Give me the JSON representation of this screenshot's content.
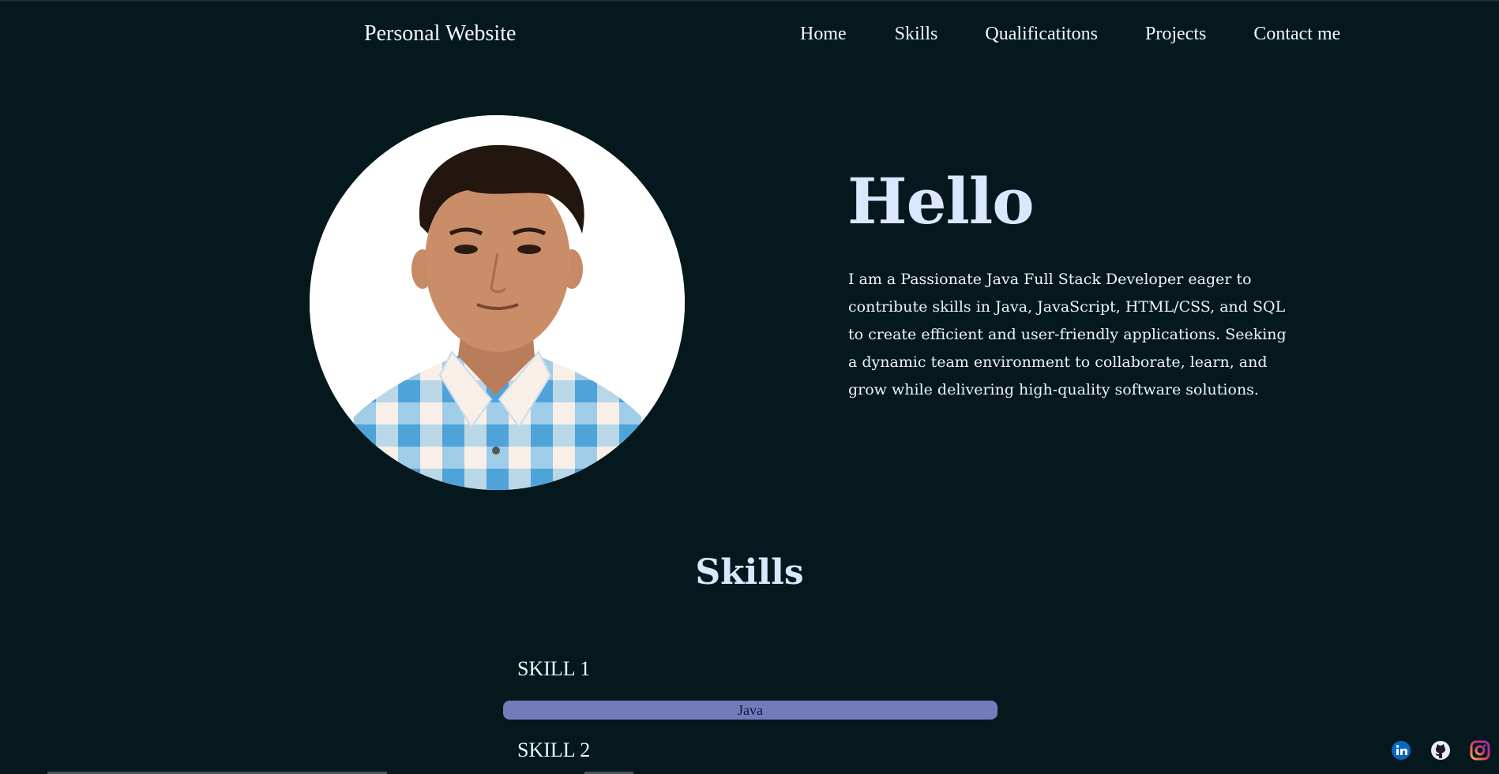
{
  "header": {
    "brand": "Personal Website",
    "nav": [
      "Home",
      "Skills",
      "Qualificatitons",
      "Projects",
      "Contact me"
    ]
  },
  "hero": {
    "title": "Hello",
    "text": "I am a Passionate Java Full Stack Developer eager to contribute skills in Java, JavaScript, HTML/CSS, and SQL to create efficient and user-friendly applications. Seeking a dynamic team environment to collaborate, learn, and grow while delivering high-quality software solutions."
  },
  "skills_section": {
    "title": "Skills",
    "items": [
      {
        "label": "SKILL 1",
        "bar_text": "Java",
        "level_fraction": 1.0
      },
      {
        "label": "SKILL 2"
      }
    ]
  },
  "social": {
    "icons": [
      "linkedin-icon",
      "github-icon",
      "instagram-icon"
    ]
  },
  "colors": {
    "background": "#05181e",
    "text": "#f2f6ff",
    "heading": "#dbe6ff",
    "skill_bar": "#727cbb"
  }
}
